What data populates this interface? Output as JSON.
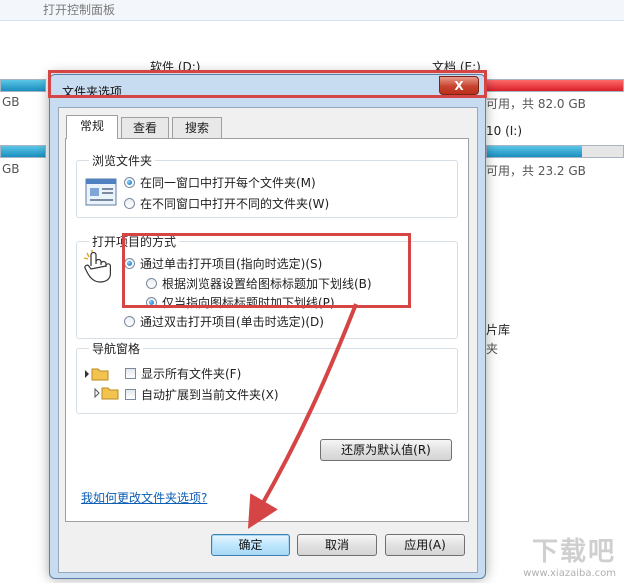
{
  "background": {
    "topbar_text": "打开控制面板",
    "drives": [
      {
        "label": "软件 (D:)"
      },
      {
        "label": "文档 (E:)",
        "free_text": "可用，共 82.0 GB"
      },
      {
        "label": "10 (I:)",
        "free_text": "可用，共 23.2 GB"
      }
    ],
    "left_gb_1": "GB",
    "left_gb_2": "GB",
    "side_text_1": "片库",
    "side_text_2": "夹"
  },
  "dialog": {
    "title": "文件夹选项",
    "close_label": "X",
    "tabs": [
      {
        "label": "常规",
        "active": true
      },
      {
        "label": "查看",
        "active": false
      },
      {
        "label": "搜索",
        "active": false
      }
    ],
    "browse": {
      "label": "浏览文件夹",
      "options": [
        {
          "label": "在同一窗口中打开每个文件夹(M)",
          "selected": true
        },
        {
          "label": "在不同窗口中打开不同的文件夹(W)",
          "selected": false
        }
      ]
    },
    "click": {
      "label": "打开项目的方式",
      "single": {
        "label": "通过单击打开项目(指向时选定)(S)",
        "selected": true
      },
      "sub_options": [
        {
          "label": "根据浏览器设置给图标标题加下划线(B)",
          "selected": false
        },
        {
          "label": "仅当指向图标标题时加下划线(P)",
          "selected": true
        }
      ],
      "double": {
        "label": "通过双击打开项目(单击时选定)(D)",
        "selected": false
      }
    },
    "nav": {
      "label": "导航窗格",
      "checks": [
        {
          "label": "显示所有文件夹(F)",
          "checked": false
        },
        {
          "label": "自动扩展到当前文件夹(X)",
          "checked": false
        }
      ]
    },
    "restore_label": "还原为默认值(R)",
    "help_link": "我如何更改文件夹选项?",
    "ok_label": "确定",
    "cancel_label": "取消",
    "apply_label": "应用(A)"
  },
  "watermark": {
    "main": "下载吧",
    "sub": "www.xiazaiba.com"
  },
  "colors": {
    "highlight": "#d64545",
    "accent": "#1a8fc0",
    "drive_full": "#d8202a"
  }
}
